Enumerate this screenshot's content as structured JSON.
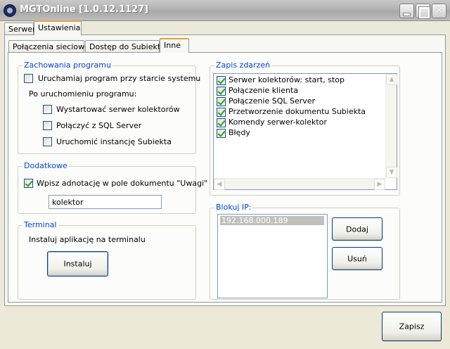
{
  "window": {
    "title": "MGTOnline [1.0.12.1127]"
  },
  "outer_tabs": [
    {
      "label": "Serwer"
    },
    {
      "label": "Ustawienia"
    }
  ],
  "inner_tabs": [
    {
      "label": "Połączenia sieciowe"
    },
    {
      "label": "Dostęp do Subiekta"
    },
    {
      "label": "Inne"
    }
  ],
  "program_behavior": {
    "title": "Zachowania programu",
    "run_at_startup": {
      "label": "Uruchamiaj program przy starcie systemu",
      "checked": false
    },
    "after_start_label": "Po uruchomieniu programu:",
    "start_collector_server": {
      "label": "Wystartować serwer kolektorów",
      "checked": false
    },
    "connect_sql": {
      "label": "Połączyć z SQL Server",
      "checked": false
    },
    "run_subiekt": {
      "label": "Uruchomić instancję Subiekta",
      "checked": false
    }
  },
  "additional": {
    "title": "Dodatkowe",
    "annotation": {
      "label": "Wpisz adnotację w pole dokumentu \"Uwagi\"",
      "checked": true
    },
    "annotation_value": "kolektor"
  },
  "terminal": {
    "title": "Terminal",
    "description": "Instaluj aplikację na terminalu",
    "install_label": "Instaluj"
  },
  "event_log": {
    "title": "Zapis zdarzeń",
    "items": [
      {
        "label": "Serwer kolektorów: start, stop",
        "checked": true
      },
      {
        "label": "Połączenie klienta",
        "checked": true
      },
      {
        "label": "Połączenie SQL Server",
        "checked": true
      },
      {
        "label": "Przetworzenie dokumentu Subiekta",
        "checked": true
      },
      {
        "label": "Komendy serwer-kolektor",
        "checked": true
      },
      {
        "label": "Błędy",
        "checked": true
      }
    ]
  },
  "block_ip": {
    "title": "Blokuj IP:",
    "items": [
      "192.168.000.189"
    ],
    "add_label": "Dodaj",
    "remove_label": "Usuń"
  },
  "footer": {
    "save_label": "Zapisz"
  }
}
